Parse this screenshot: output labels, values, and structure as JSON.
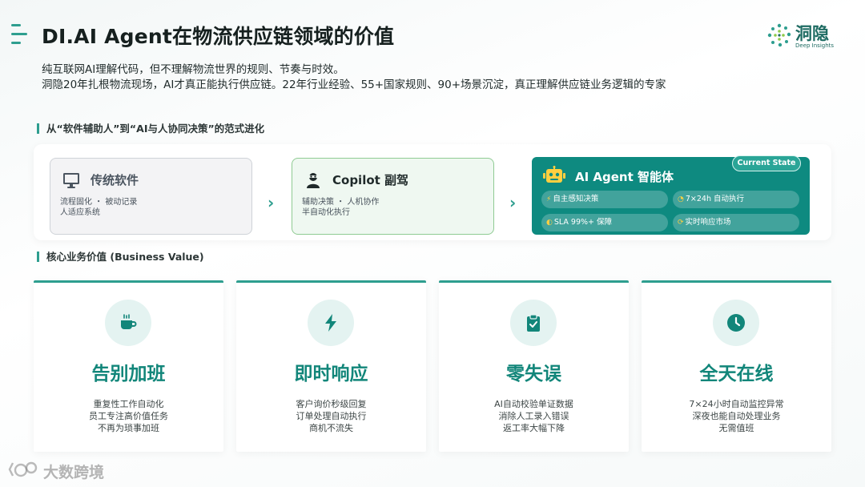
{
  "header": {
    "title": "DI.AI Agent在物流供应链领域的价值",
    "logo": {
      "name": "洞隐",
      "sub": "Deep Insights"
    }
  },
  "intro": {
    "line1": "纯互联网AI理解代码，但不理解物流世界的规则、节奏与时效。",
    "line2": "洞隐20年扎根物流现场，AI才真正能执行供应链。22年行业经验、55+国家规则、90+场景沉淀，真正理解供应链业务逻辑的专家"
  },
  "evolution": {
    "heading": "从“软件辅助人”到“AI与人协同决策”的范式进化",
    "stages": [
      {
        "title": "传统软件",
        "icon": "monitor-icon",
        "desc1": "流程固化 ・ 被动记录",
        "desc2": "人适应系统"
      },
      {
        "title": "Copilot 副驾",
        "icon": "pilot-icon",
        "desc1": "辅助决策 ・ 人机协作",
        "desc2": "半自动化执行"
      },
      {
        "title": "AI Agent 智能体",
        "icon": "robot-icon",
        "badge": "Current State",
        "chips": [
          {
            "icon": "bolt-icon",
            "label": "自主感知决策"
          },
          {
            "icon": "clock-icon",
            "label": "7×24h 自动执行"
          },
          {
            "icon": "shield-icon",
            "label": "SLA 99%+ 保障"
          },
          {
            "icon": "refresh-icon",
            "label": "实时响应市场"
          }
        ]
      }
    ],
    "arrow": "›"
  },
  "value": {
    "heading": "核心业务价值 (Business Value)",
    "cards": [
      {
        "icon": "coffee-icon",
        "title": "告别加班",
        "lines": [
          "重复性工作自动化",
          "员工专注高价值任务",
          "不再为琐事加班"
        ]
      },
      {
        "icon": "bolt-icon",
        "title": "即时响应",
        "lines": [
          "客户询价秒级回复",
          "订单处理自动执行",
          "商机不流失"
        ]
      },
      {
        "icon": "clipboard-check-icon",
        "title": "零失误",
        "lines": [
          "AI自动校验单证数据",
          "消除人工录入错误",
          "返工率大幅下降"
        ]
      },
      {
        "icon": "clock-icon",
        "title": "全天在线",
        "lines": [
          "7×24小时自动监控异常",
          "深夜也能自动处理业务",
          "无需值班"
        ]
      }
    ]
  },
  "watermark": {
    "text": "大数跨境"
  },
  "colors": {
    "accent": "#2e9e8f",
    "agent_bg": "#0e8a80",
    "value_title": "#12867a",
    "chip_icon": "#ffcf40"
  }
}
